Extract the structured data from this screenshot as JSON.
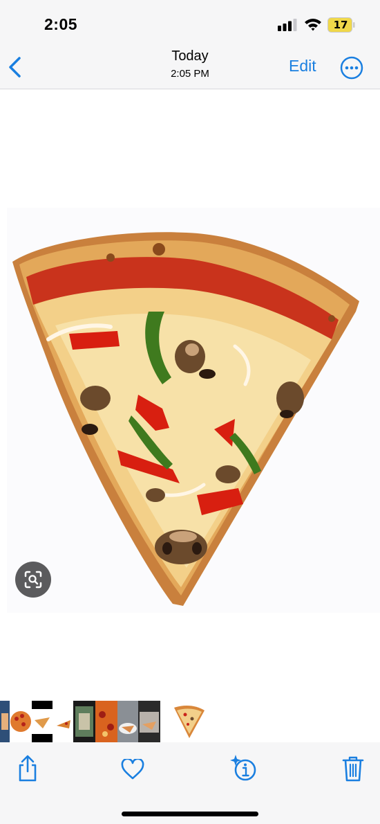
{
  "status_bar": {
    "time": "2:05",
    "battery_level": "17"
  },
  "nav": {
    "title": "Today",
    "subtitle": "2:05 PM",
    "edit_label": "Edit"
  },
  "photo": {
    "subject": "pizza slice with peppers, mushrooms and onions"
  },
  "filmstrip": {
    "thumbnail_count": 10
  },
  "toolbar": {
    "share_icon": "share-icon",
    "favorite_icon": "heart-icon",
    "info_icon": "sparkle-info-icon",
    "delete_icon": "trash-icon"
  },
  "colors": {
    "accent": "#1a7fe0",
    "bar_bg": "#f6f6f7"
  }
}
